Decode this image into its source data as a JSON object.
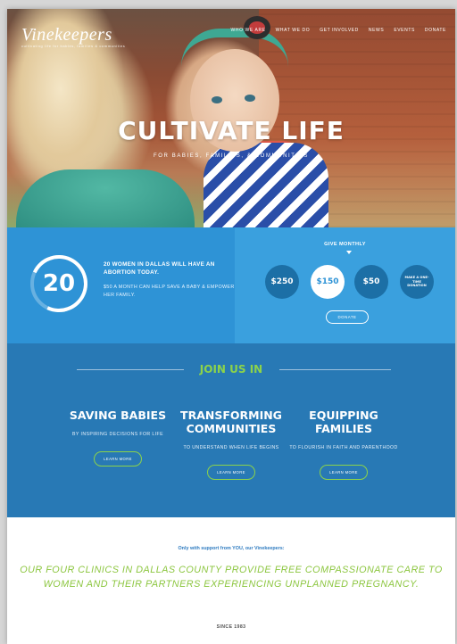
{
  "header": {
    "logo_text": "Vinekeepers",
    "logo_tagline": "cultivating life for babies, families & communities",
    "nav": [
      "WHO WE ARE",
      "WHAT WE DO",
      "GET INVOLVED",
      "NEWS",
      "EVENTS",
      "DONATE"
    ]
  },
  "hero": {
    "title": "CULTIVATE LIFE",
    "subtitle": "FOR BABIES, FAMILIES, & COMMUNITIES"
  },
  "stats": {
    "number": "20",
    "headline": "20 WOMEN IN DALLAS WILL HAVE AN ABORTION TODAY.",
    "subtext": "$50 A MONTH CAN HELP SAVE A BABY & EMPOWER HER FAMILY."
  },
  "give": {
    "label": "GIVE MONTHLY",
    "amounts": [
      "$250",
      "$150",
      "$50",
      "MAKE A ONE-TIME DONATION"
    ],
    "selected": "$150",
    "donate_label": "DONATE"
  },
  "join": {
    "title": "JOIN US IN",
    "columns": [
      {
        "heading": "SAVING BABIES",
        "desc": "BY INSPIRING DECISIONS FOR LIFE",
        "button": "LEARN MORE"
      },
      {
        "heading": "TRANSFORMING COMMUNITIES",
        "desc": "TO UNDERSTAND WHEN LIFE BEGINS",
        "button": "LEARN MORE"
      },
      {
        "heading": "EQUIPPING FAMILIES",
        "desc": "TO FLOURISH IN FAITH AND PARENTHOOD",
        "button": "LEARN MORE"
      }
    ]
  },
  "bottom": {
    "support": "Only with support from YOU, our Vinekeepers:",
    "clinics": "OUR FOUR CLINICS IN DALLAS COUNTY PROVIDE FREE COMPASSIONATE CARE TO WOMEN AND THEIR PARTNERS EXPERIENCING UNPLANNED PREGNANCY.",
    "since": "SINCE 1983"
  },
  "colors": {
    "band_blue": "#2e93d6",
    "join_blue": "#2879b5",
    "accent_green": "#8cd34a",
    "dark_circle": "#1c6fa6"
  }
}
